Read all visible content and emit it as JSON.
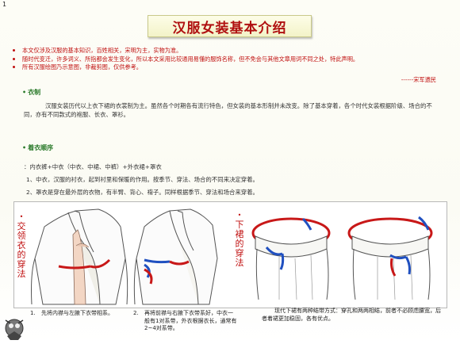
{
  "page_number": "1",
  "title": "汉服女装基本介绍",
  "notes": [
    "本文仅涉及汉服的基本知识，百姓相关，宋明为主，实物为准。",
    "随时代变迁，许多词义、所指都会发生变化，所以本文采用比较通用易懂的服饰名称，但不免会与其他文章用词不同之处，特此声明。",
    "所有汉服绘图乃示意图，非裁剪图，仅供参考。"
  ],
  "signature": "------宋军遗民",
  "section1": {
    "heading": "衣制",
    "body": "汉服女装历代以上衣下裙的衣裳制为主。虽然各个时期各有流行特色，但女装的基本形制并未改变。除了基本穿着，各个时代女装根据阶级、场合的不同，亦有不同款式的袍服、长衣、罩衫。"
  },
  "section2": {
    "heading": "着衣顺序",
    "order": "：内衣裤+中衣（中衣、中裙、中裤）+外衣裙+罩衣",
    "item1": "1、中衣，汉服的衬衣，起到衬里和保暖的作用。按季节、穿法、场合的不同来决定穿着。",
    "item2": "2、罩衣是穿在最外层的衣物，有半臂、背心、褙子。同样根据季节、穿法和场合来穿着。"
  },
  "figure": {
    "left_label": "交领衣的穿法",
    "right_label": "下裙的穿法",
    "caption1_num": "1.",
    "caption1": "先将内襟与左腋下衣带相系。",
    "caption2_num": "2.",
    "caption2": "再将前襟与右腋下衣带系好，中衣一般有1对系带，外衣根据衣长，通常有2~4对系带。",
    "caption3": "现代下裙有两种结带方式：穿孔和两两相结，前者不必顾虑腰宽，后者着裙更加稳固，各有优点。"
  },
  "colors": {
    "title_red": "#b01010",
    "note_red": "#c01010",
    "heading_green": "#2a7a2a",
    "tie_red": "#c81818",
    "tie_blue": "#2050c0"
  }
}
